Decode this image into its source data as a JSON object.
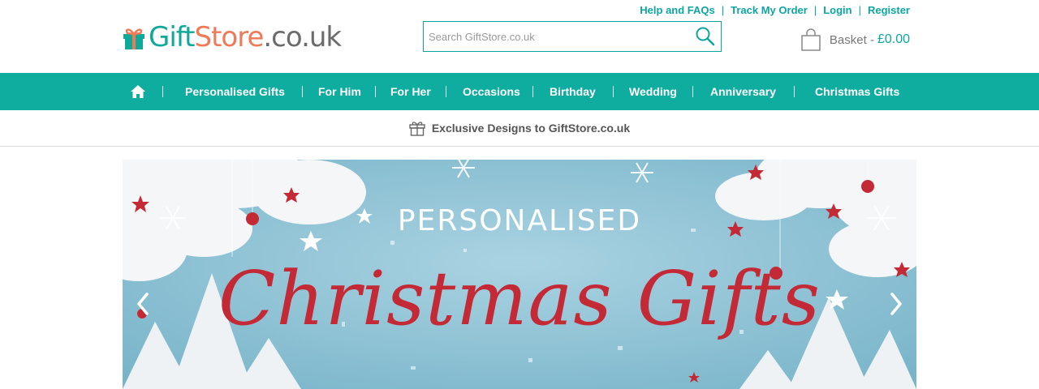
{
  "logo": {
    "gift": "Gift",
    "store": "Store",
    "tld": ".co.uk"
  },
  "toplinks": {
    "help": "Help and FAQs",
    "track": "Track My Order",
    "login": "Login",
    "register": "Register",
    "separator": "|"
  },
  "search": {
    "placeholder": "Search GiftStore.co.uk",
    "value": ""
  },
  "basket": {
    "label": "Basket -",
    "amount": "£0.00"
  },
  "nav": {
    "home_icon": "home-icon",
    "items": [
      "Personalised Gifts",
      "For Him",
      "For Her",
      "Occasions",
      "Birthday",
      "Wedding",
      "Anniversary",
      "Christmas Gifts"
    ]
  },
  "promo": {
    "icon": "gift-icon",
    "text": "Exclusive Designs to GiftStore.co.uk"
  },
  "banner": {
    "subtitle": "PERSONALISED",
    "title": "Christmas Gifts",
    "prev_icon": "chevron-left-icon",
    "next_icon": "chevron-right-icon"
  },
  "colors": {
    "teal": "#0fada0",
    "coral": "#ef7a57",
    "banner_bg": "#8fc4d6",
    "banner_title": "#c42a36"
  }
}
